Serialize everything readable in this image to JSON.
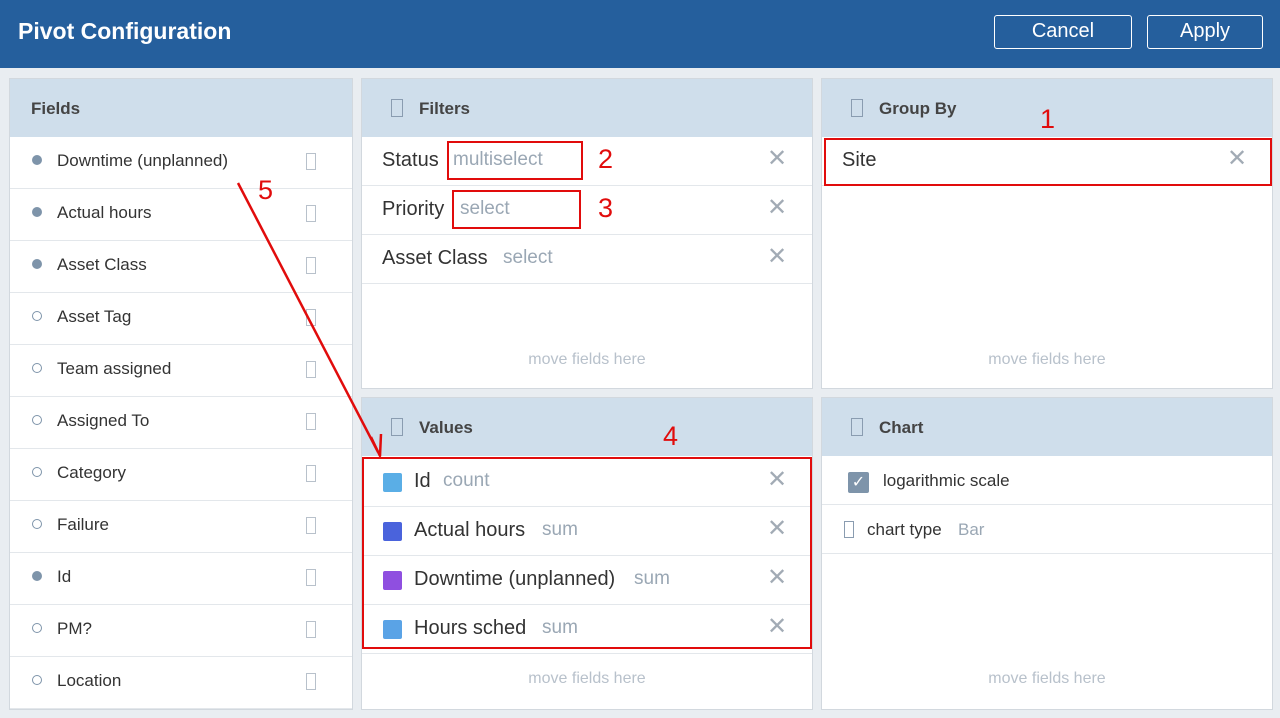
{
  "header": {
    "title": "Pivot Configuration",
    "cancel_label": "Cancel",
    "apply_label": "Apply"
  },
  "fields_panel": {
    "title": "Fields",
    "items": [
      {
        "label": "Downtime (unplanned)",
        "active": true
      },
      {
        "label": "Actual hours",
        "active": true
      },
      {
        "label": "Asset Class",
        "active": true
      },
      {
        "label": "Asset Tag",
        "active": false
      },
      {
        "label": "Team assigned",
        "active": false
      },
      {
        "label": "Assigned To",
        "active": false
      },
      {
        "label": "Category",
        "active": false
      },
      {
        "label": "Failure",
        "active": false
      },
      {
        "label": "Id",
        "active": true
      },
      {
        "label": "PM?",
        "active": false
      },
      {
        "label": "Location",
        "active": false
      }
    ]
  },
  "filters_panel": {
    "title": "Filters",
    "items": [
      {
        "label": "Status",
        "type": "multiselect"
      },
      {
        "label": "Priority",
        "type": "select"
      },
      {
        "label": "Asset Class",
        "type": "select"
      }
    ],
    "placeholder": "move fields here"
  },
  "groupby_panel": {
    "title": "Group By",
    "items": [
      {
        "label": "Site"
      }
    ],
    "placeholder": "move fields here"
  },
  "values_panel": {
    "title": "Values",
    "items": [
      {
        "label": "Id",
        "agg": "count",
        "color": "#5aaee6"
      },
      {
        "label": "Actual hours",
        "agg": "sum",
        "color": "#4a63dc"
      },
      {
        "label": "Downtime (unplanned)",
        "agg": "sum",
        "color": "#8f4fe0"
      },
      {
        "label": "Hours sched",
        "agg": "sum",
        "color": "#5aa3e6"
      }
    ],
    "placeholder": "move fields here"
  },
  "chart_panel": {
    "title": "Chart",
    "log_scale_label": "logarithmic scale",
    "log_scale_checked": true,
    "chart_type_label": "chart type",
    "chart_type_value": "Bar",
    "placeholder": "move fields here"
  },
  "annotations": {
    "n1": "1",
    "n2": "2",
    "n3": "3",
    "n4": "4",
    "n5": "5",
    "color": "#e10c0c"
  }
}
